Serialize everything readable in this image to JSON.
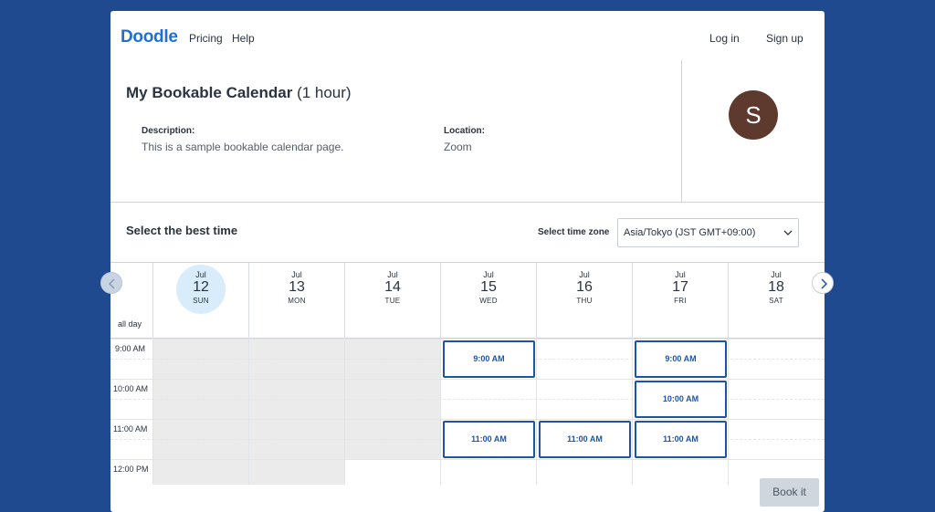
{
  "header": {
    "logo": "Doodle",
    "nav": {
      "pricing": "Pricing",
      "help": "Help",
      "login": "Log in",
      "signup": "Sign up"
    }
  },
  "event": {
    "title": "My Bookable Calendar",
    "duration": "(1 hour)",
    "description_label": "Description:",
    "description": "This is a sample bookable calendar page.",
    "location_label": "Location:",
    "location": "Zoom"
  },
  "avatar": {
    "initial": "S",
    "color": "#5e3a2e"
  },
  "scheduler": {
    "title": "Select the best time",
    "timezone_label": "Select time zone",
    "timezone_value": "Asia/Tokyo (JST GMT+09:00)",
    "allday_label": "all day",
    "days": [
      {
        "month": "Jul",
        "day": "12",
        "weekday": "SUN",
        "today": true
      },
      {
        "month": "Jul",
        "day": "13",
        "weekday": "MON"
      },
      {
        "month": "Jul",
        "day": "14",
        "weekday": "TUE"
      },
      {
        "month": "Jul",
        "day": "15",
        "weekday": "WED"
      },
      {
        "month": "Jul",
        "day": "16",
        "weekday": "THU"
      },
      {
        "month": "Jul",
        "day": "17",
        "weekday": "FRI"
      },
      {
        "month": "Jul",
        "day": "18",
        "weekday": "SAT"
      }
    ],
    "hours": [
      "9:00 AM",
      "10:00 AM",
      "11:00 AM",
      "12:00 PM"
    ],
    "slots": [
      {
        "day": "15",
        "label": "9:00 AM"
      },
      {
        "day": "17",
        "label": "9:00 AM"
      },
      {
        "day": "17",
        "label": "10:00 AM"
      },
      {
        "day": "15",
        "label": "11:00 AM"
      },
      {
        "day": "16",
        "label": "11:00 AM"
      },
      {
        "day": "17",
        "label": "11:00 AM"
      }
    ],
    "book_button": "Book it"
  },
  "colors": {
    "background": "#1f4a8f",
    "brand": "#1e6fd9",
    "slot_border": "#1c55a8",
    "unavailable": "#ebebeb",
    "today_highlight": "#d9ecfb"
  },
  "icons": {
    "prev": "chevron-left-icon",
    "next": "chevron-right-icon",
    "dropdown": "chevron-down-icon"
  }
}
